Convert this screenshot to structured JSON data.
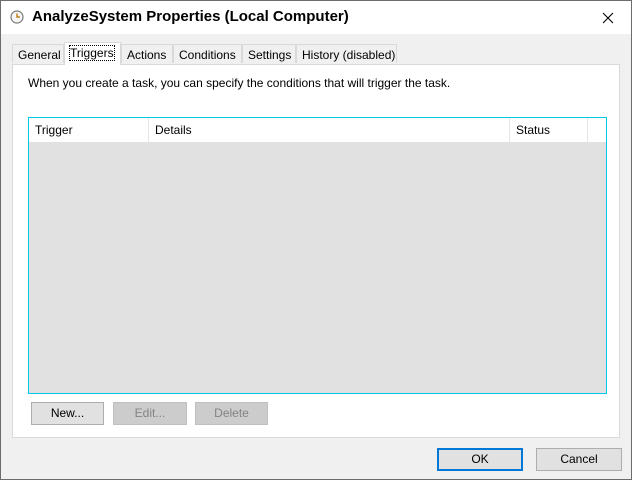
{
  "window": {
    "title": "AnalyzeSystem Properties (Local Computer)",
    "title_icon": "task-scheduler-icon",
    "close_icon": "close-icon"
  },
  "tabs": [
    {
      "label": "General",
      "active": false
    },
    {
      "label": "Triggers",
      "active": true
    },
    {
      "label": "Actions",
      "active": false
    },
    {
      "label": "Conditions",
      "active": false
    },
    {
      "label": "Settings",
      "active": false
    },
    {
      "label": "History (disabled)",
      "active": false
    }
  ],
  "triggers_panel": {
    "description": "When you create a task, you can specify the conditions that will trigger the task.",
    "columns": [
      "Trigger",
      "Details",
      "Status"
    ],
    "rows": [],
    "buttons": {
      "new": {
        "label": "New...",
        "enabled": true
      },
      "edit": {
        "label": "Edit...",
        "enabled": false
      },
      "delete": {
        "label": "Delete",
        "enabled": false
      }
    }
  },
  "footer": {
    "ok_label": "OK",
    "cancel_label": "Cancel"
  },
  "colors": {
    "accent": "#0078d7",
    "listview_border": "#00c8e8",
    "listview_bg": "#e1e1e1"
  }
}
